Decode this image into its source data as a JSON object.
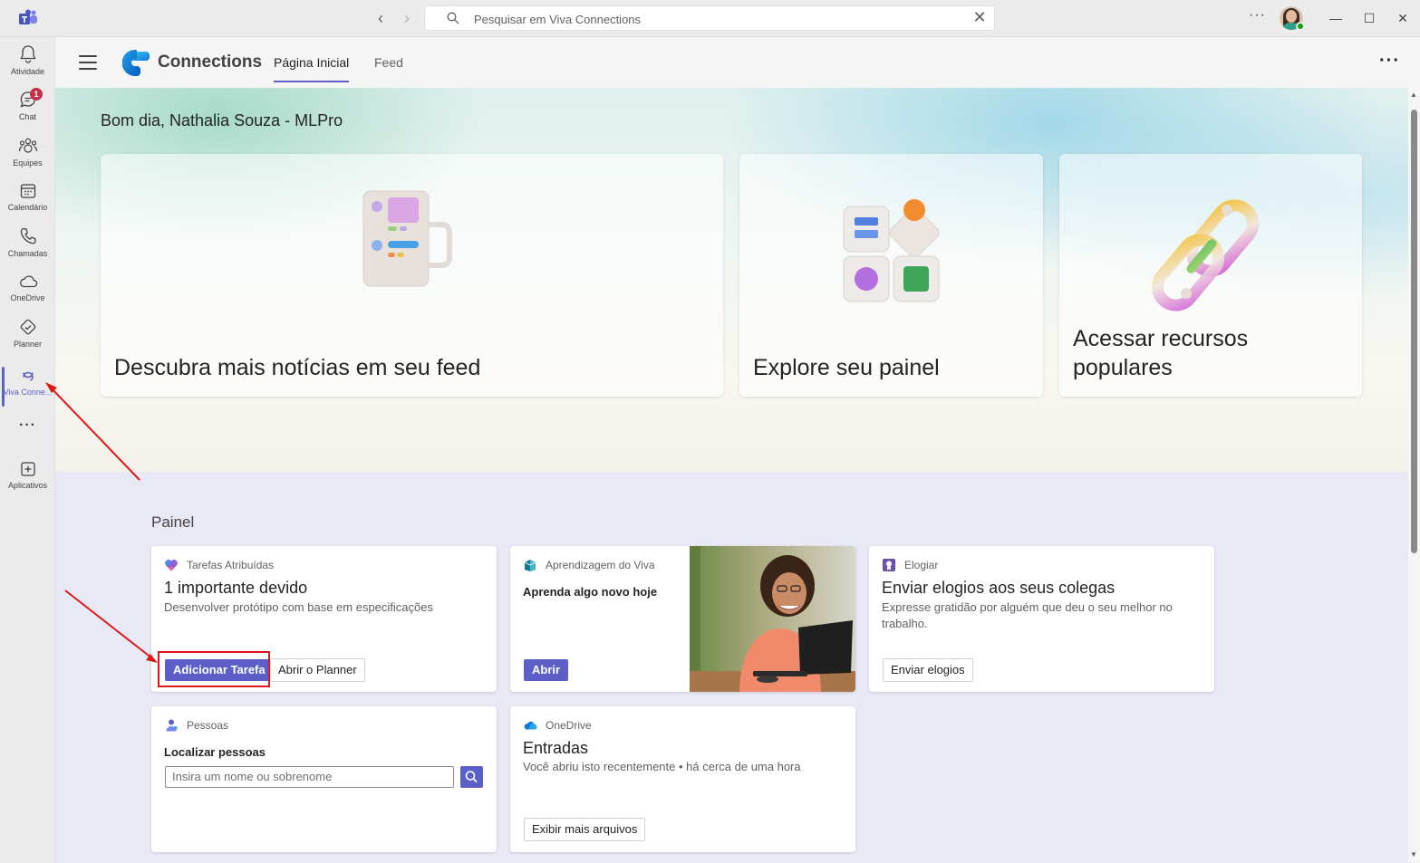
{
  "titlebar": {
    "search_placeholder": "Pesquisar em Viva Connections",
    "more_label": "···",
    "minimize": "—",
    "maximize": "☐",
    "close": "✕"
  },
  "rail": {
    "items": [
      {
        "label": "Atividade",
        "icon": "bell-icon"
      },
      {
        "label": "Chat",
        "icon": "chat-icon",
        "badge": "1"
      },
      {
        "label": "Equipes",
        "icon": "teams-icon"
      },
      {
        "label": "Calendário",
        "icon": "calendar-icon"
      },
      {
        "label": "Chamadas",
        "icon": "phone-icon"
      },
      {
        "label": "OneDrive",
        "icon": "cloud-icon"
      },
      {
        "label": "Planner",
        "icon": "planner-icon"
      },
      {
        "label": "Viva Conne...",
        "icon": "viva-connections-icon",
        "active": true
      },
      {
        "label": "",
        "icon": "more-icon"
      },
      {
        "label": "Aplicativos",
        "icon": "add-app-icon"
      }
    ],
    "more": "···"
  },
  "header": {
    "app_title": "Connections",
    "tabs": [
      {
        "label": "Página Inicial",
        "active": true
      },
      {
        "label": "Feed",
        "active": false
      }
    ],
    "more": "···"
  },
  "hero": {
    "greeting": "Bom dia, Nathalia Souza - MLPro",
    "cards": [
      {
        "title": "Descubra mais notícias em seu feed"
      },
      {
        "title": "Explore seu painel"
      },
      {
        "title": "Acessar recursos populares"
      }
    ]
  },
  "dashboard": {
    "title": "Painel",
    "tasks": {
      "source": "Tarefas Atribuídas",
      "heading": "1 importante devido",
      "subtitle": "Desenvolver protótipo com base em especificações",
      "primary_button": "Adicionar Tarefa",
      "secondary_button": "Abrir o Planner"
    },
    "learning": {
      "source": "Aprendizagem do Viva",
      "heading": "Aprenda algo novo hoje",
      "button": "Abrir"
    },
    "praise": {
      "source": "Elogiar",
      "heading": "Enviar elogios aos seus colegas",
      "subtitle": "Expresse gratidão por alguém que deu o seu melhor no trabalho.",
      "button": "Enviar elogios"
    },
    "people": {
      "source": "Pessoas",
      "heading": "Localizar pessoas",
      "placeholder": "Insira um nome ou sobrenome"
    },
    "onedrive": {
      "source": "OneDrive",
      "heading": "Entradas",
      "subtitle": "Você abriu isto recentemente • há cerca de uma hora",
      "button": "Exibir mais arquivos"
    }
  },
  "colors": {
    "accent": "#5b5fc7",
    "annotation": "#e01818"
  }
}
